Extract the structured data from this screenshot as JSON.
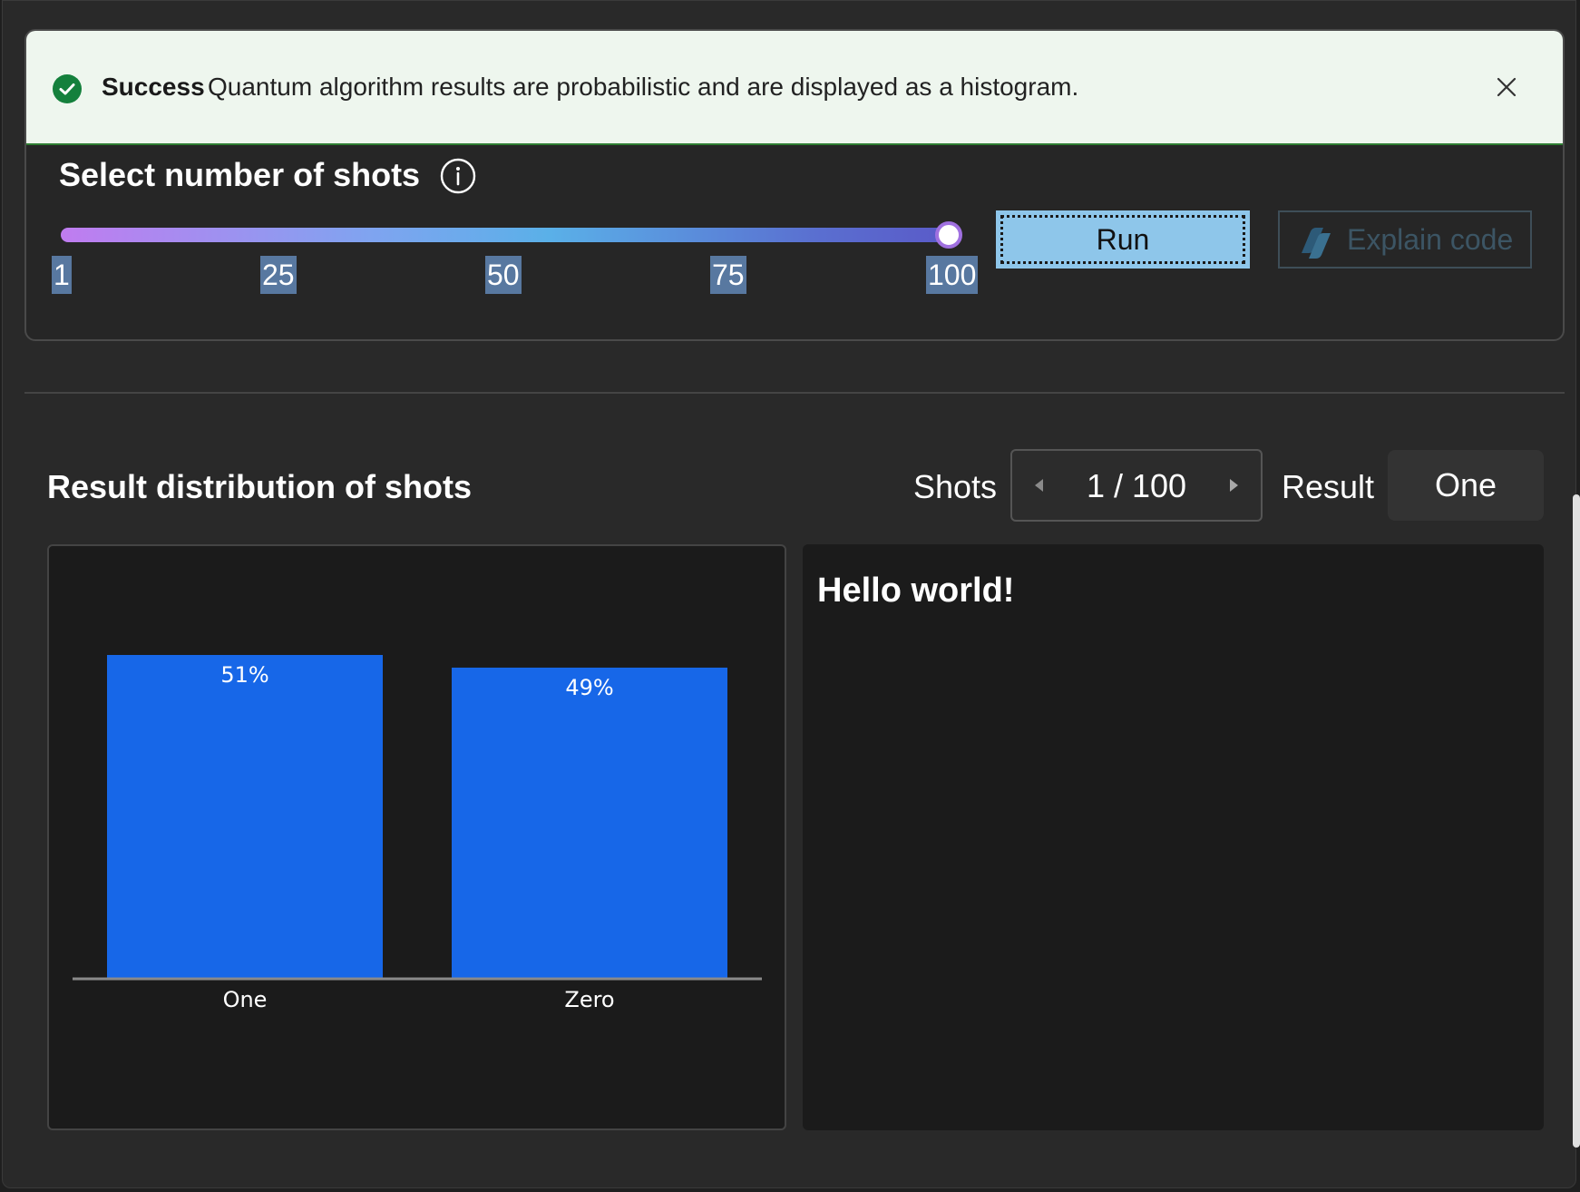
{
  "banner": {
    "title": "Success",
    "message": "Quantum algorithm results are probabilistic and are displayed as a histogram.",
    "status_color": "#14803c"
  },
  "shots_section": {
    "title": "Select number of shots",
    "slider": {
      "min": 1,
      "max": 100,
      "value": 100
    },
    "ticks": [
      "1",
      "25",
      "50",
      "75",
      "100"
    ],
    "run_label": "Run",
    "explain_label": "Explain code"
  },
  "results": {
    "title": "Result distribution of shots",
    "shots_label": "Shots",
    "shots_value": "1 / 100",
    "result_label": "Result",
    "result_value": "One",
    "output_text": "Hello world!"
  },
  "chart_data": {
    "type": "bar",
    "categories": [
      "One",
      "Zero"
    ],
    "values": [
      51,
      49
    ],
    "value_labels": [
      "51%",
      "49%"
    ],
    "bar_color": "#1767e8"
  }
}
